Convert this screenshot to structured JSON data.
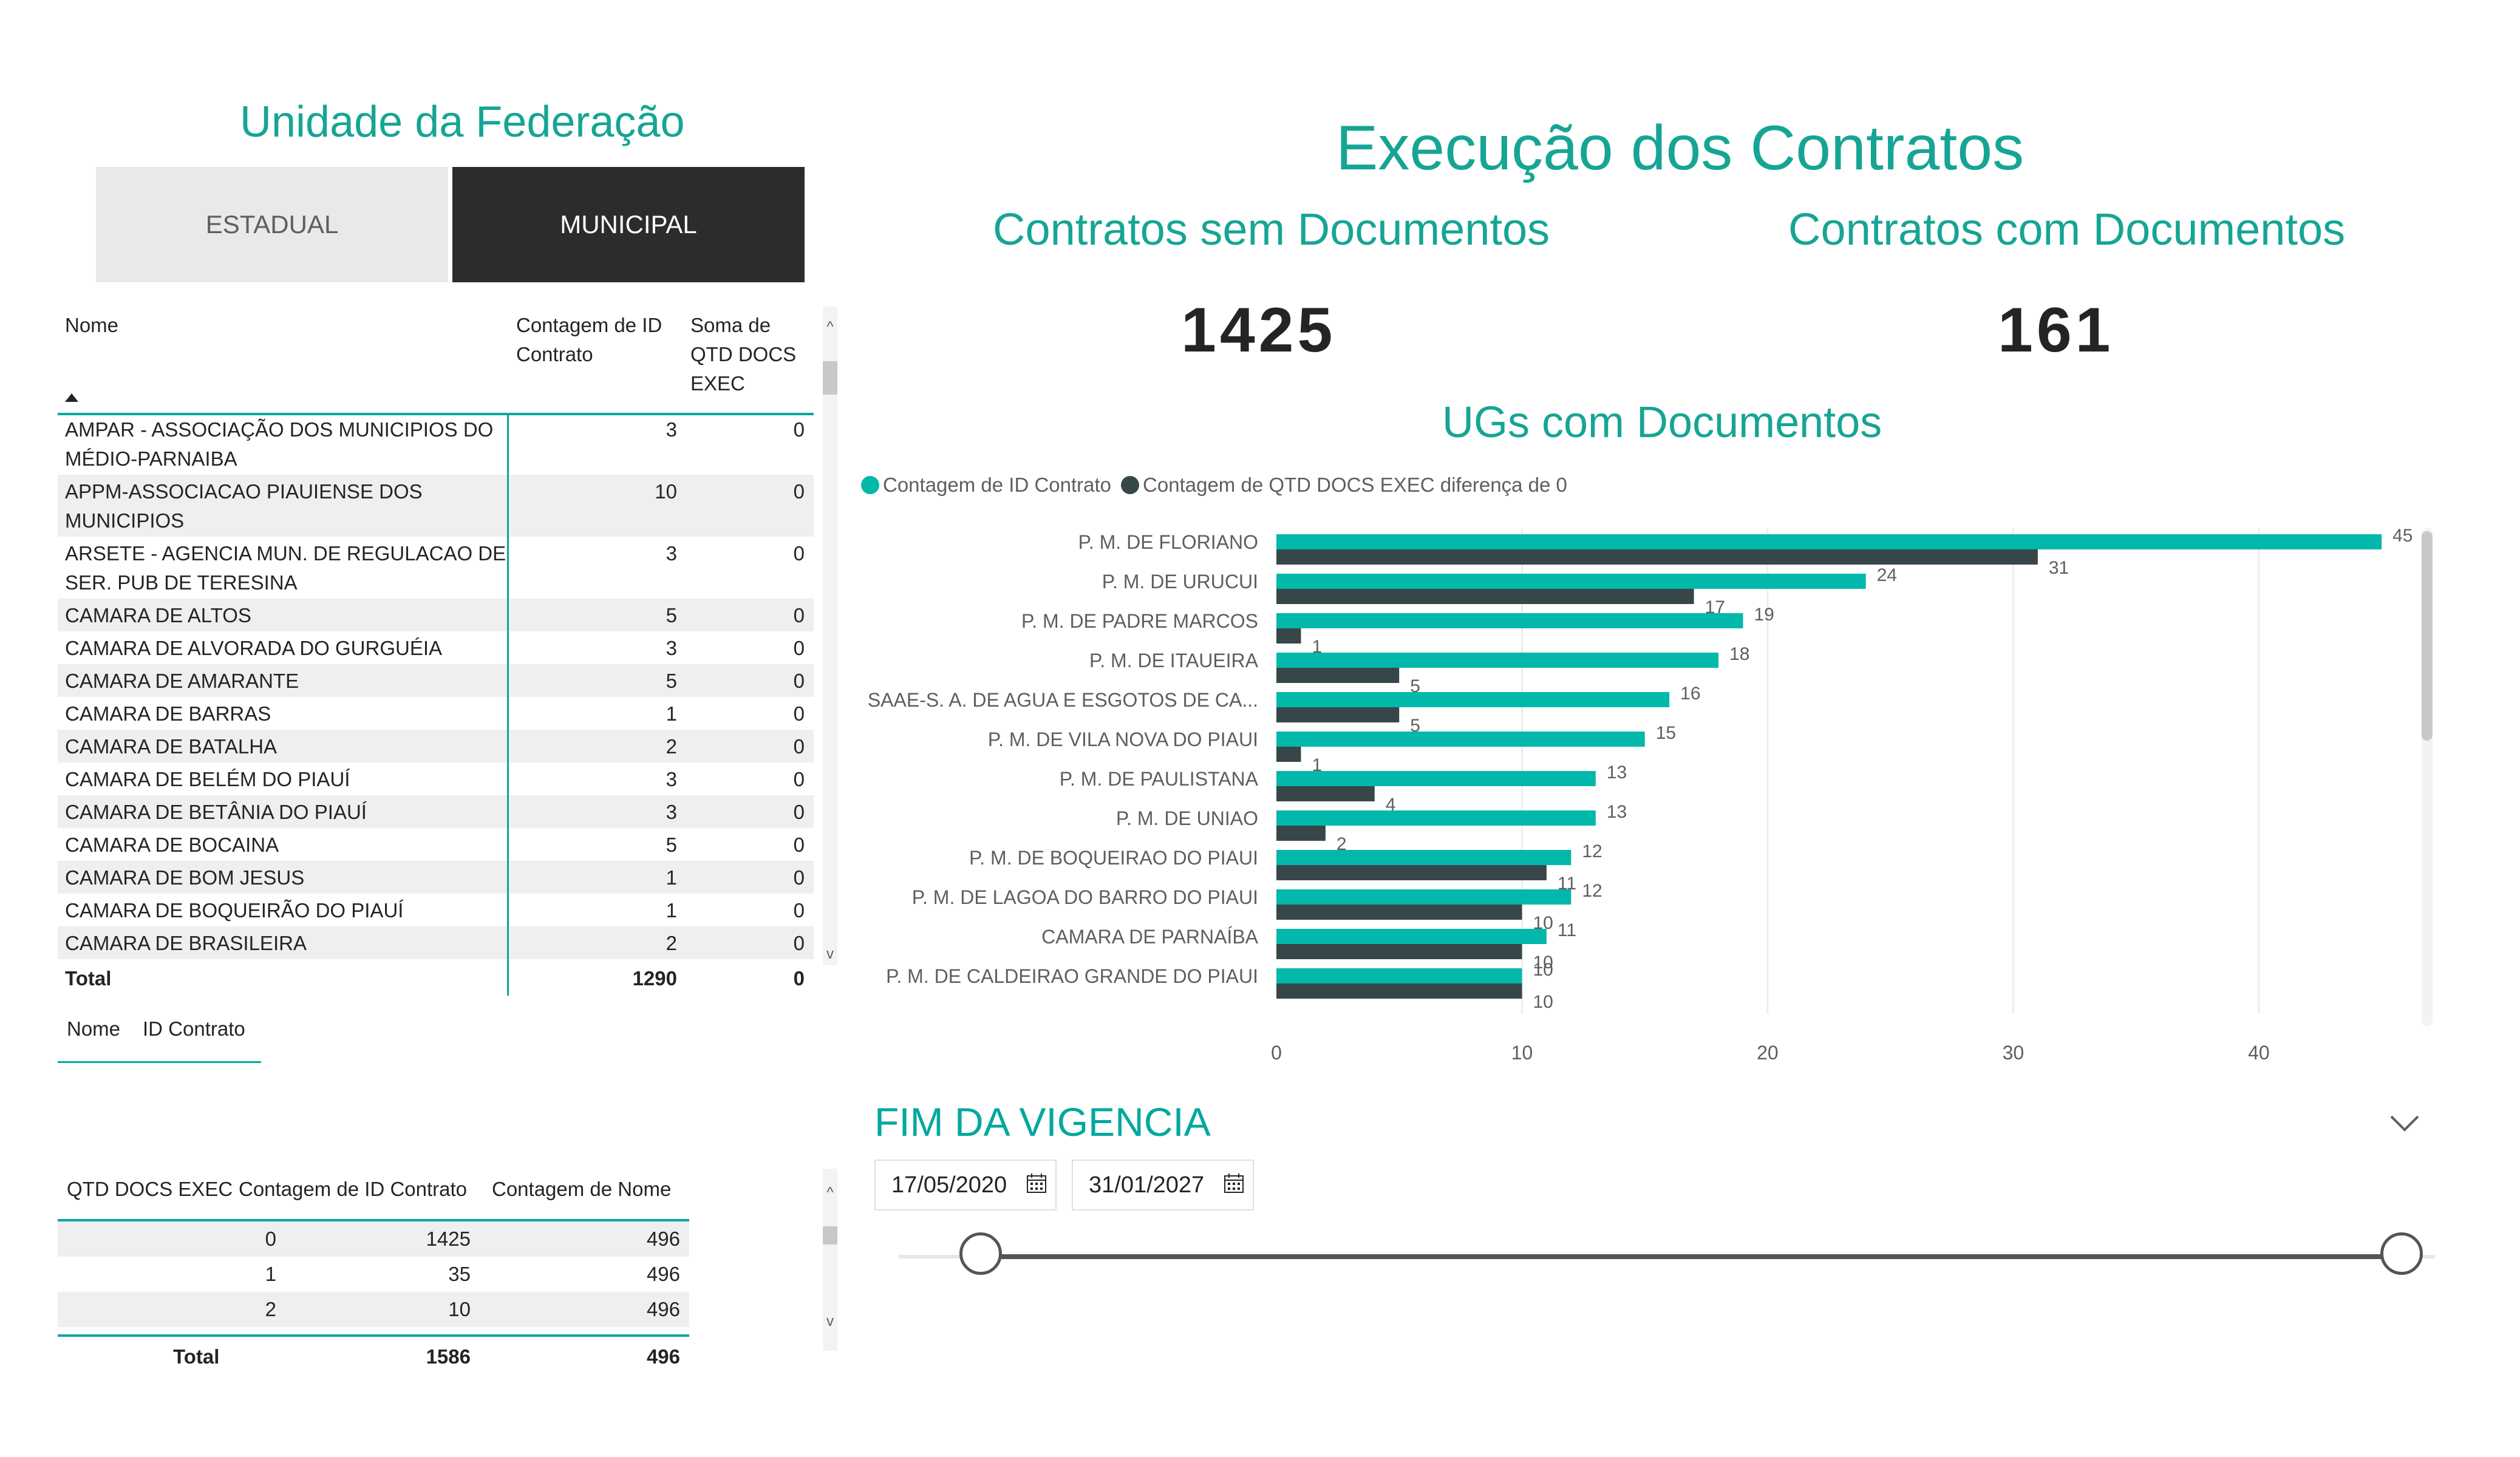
{
  "slicer": {
    "title": "Unidade da Federação",
    "options": [
      "ESTADUAL",
      "MUNICIPAL"
    ],
    "selected": "MUNICIPAL"
  },
  "main_table": {
    "headers": [
      "Nome",
      "Contagem de ID Contrato",
      "Soma de QTD DOCS EXEC"
    ],
    "header_lines": {
      "count": [
        "Contagem de ID",
        "Contrato"
      ],
      "sum": [
        "Soma de",
        "QTD DOCS",
        "EXEC"
      ]
    },
    "rows": [
      {
        "name": [
          "AMPAR - ASSOCIAÇÃO DOS MUNICIPIOS DO",
          "MÉDIO-PARNAIBA"
        ],
        "count": "3",
        "sum": "0"
      },
      {
        "name": [
          "APPM-ASSOCIACAO PIAUIENSE DOS",
          "MUNICIPIOS"
        ],
        "count": "10",
        "sum": "0"
      },
      {
        "name": [
          "ARSETE - AGENCIA MUN. DE REGULACAO DE",
          "SER. PUB DE TERESINA"
        ],
        "count": "3",
        "sum": "0"
      },
      {
        "name": [
          "CAMARA DE ALTOS"
        ],
        "count": "5",
        "sum": "0"
      },
      {
        "name": [
          "CAMARA DE ALVORADA DO GURGUÉIA"
        ],
        "count": "3",
        "sum": "0"
      },
      {
        "name": [
          "CAMARA DE AMARANTE"
        ],
        "count": "5",
        "sum": "0"
      },
      {
        "name": [
          "CAMARA DE BARRAS"
        ],
        "count": "1",
        "sum": "0"
      },
      {
        "name": [
          "CAMARA DE BATALHA"
        ],
        "count": "2",
        "sum": "0"
      },
      {
        "name": [
          "CAMARA DE BELÉM DO PIAUÍ"
        ],
        "count": "3",
        "sum": "0"
      },
      {
        "name": [
          "CAMARA DE BETÂNIA DO PIAUÍ"
        ],
        "count": "3",
        "sum": "0"
      },
      {
        "name": [
          "CAMARA DE BOCAINA"
        ],
        "count": "5",
        "sum": "0"
      },
      {
        "name": [
          "CAMARA DE BOM JESUS"
        ],
        "count": "1",
        "sum": "0"
      },
      {
        "name": [
          "CAMARA DE BOQUEIRÃO DO PIAUÍ"
        ],
        "count": "1",
        "sum": "0"
      },
      {
        "name": [
          "CAMARA DE BRASILEIRA"
        ],
        "count": "2",
        "sum": "0"
      }
    ],
    "total": {
      "label": "Total",
      "count": "1290",
      "sum": "0"
    },
    "field_tabs": [
      "Nome",
      "ID Contrato"
    ]
  },
  "docs_table": {
    "headers": [
      "QTD DOCS EXEC",
      "Contagem de ID Contrato",
      "Contagem de Nome"
    ],
    "rows": [
      {
        "qtd": "0",
        "count_id": "1425",
        "count_nome": "496"
      },
      {
        "qtd": "1",
        "count_id": "35",
        "count_nome": "496"
      },
      {
        "qtd": "2",
        "count_id": "10",
        "count_nome": "496"
      }
    ],
    "total": {
      "label": "Total",
      "count_id": "1586",
      "count_nome": "496"
    }
  },
  "header": {
    "title": "Execução dos Contratos",
    "kpi_sem_label": "Contratos sem Documentos",
    "kpi_sem_value": "1425",
    "kpi_com_label": "Contratos com Documentos",
    "kpi_com_value": "161"
  },
  "chart_data": {
    "type": "bar",
    "orientation": "horizontal",
    "title": "UGs com Documentos",
    "categories": [
      "P. M. DE FLORIANO",
      "P. M. DE URUCUI",
      "P. M. DE PADRE MARCOS",
      "P. M. DE ITAUEIRA",
      "SAAE-S. A. DE AGUA E ESGOTOS DE CA...",
      "P. M. DE VILA NOVA DO PIAUI",
      "P. M. DE PAULISTANA",
      "P. M. DE UNIAO",
      "P. M. DE BOQUEIRAO DO PIAUI",
      "P. M. DE LAGOA DO BARRO DO PIAUI",
      "CAMARA DE PARNAÍBA",
      "P. M. DE CALDEIRAO GRANDE DO PIAUI"
    ],
    "series": [
      {
        "name": "Contagem de ID Contrato",
        "color": "#01B8AA",
        "values": [
          45,
          24,
          19,
          18,
          16,
          15,
          13,
          13,
          12,
          12,
          11,
          10
        ]
      },
      {
        "name": "Contagem de QTD DOCS EXEC diferença de 0",
        "color": "#374649",
        "values": [
          31,
          17,
          1,
          5,
          5,
          1,
          4,
          2,
          11,
          10,
          10,
          10
        ]
      }
    ],
    "xlim": [
      0,
      47
    ],
    "xticks": [
      0,
      10,
      20,
      30,
      40
    ],
    "legend": "top-left",
    "grid": true
  },
  "vigencia": {
    "title": "FIM DA VIGENCIA",
    "start_date": "17/05/2020",
    "end_date": "31/01/2027",
    "range_fraction": [
      0,
      1
    ]
  }
}
